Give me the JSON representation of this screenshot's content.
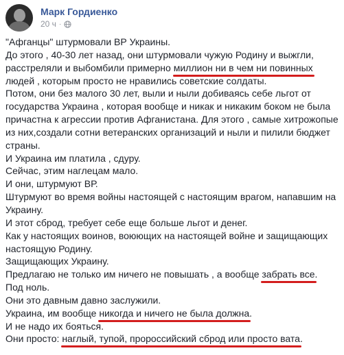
{
  "header": {
    "author": "Марк Гордиенко",
    "time": "20 ч",
    "separator": "·",
    "privacy_icon": "globe-icon"
  },
  "colors": {
    "author_link": "#385898",
    "meta": "#90949c",
    "underline": "#d31d1d"
  },
  "post": {
    "l1": "\"Афганцы\" штурмовали ВР Украины.",
    "l2": "До этого , 40-30 лет назад, они штурмовали чужую Родину и выжгли,",
    "l3_pre": "расстреляли и выбомбили примерно ",
    "l3_hl": "миллион ни в чем ни повинных",
    "l4": "людей , которым просто не нравились советские солдаты.",
    "l5": "Потом, они без малого 30 лет, выли и ныли добиваясь себе льгот от",
    "l6": "государства Украина , которая вообще и никак и никаким боком не была",
    "l7": "причастна к агрессии против Афганистана. Для этого , самые хитрожопые",
    "l8": "из них,создали сотни ветеранских организаций и ныли и пилили бюджет",
    "l9": "страны.",
    "l10": "И Украина им платила , сдуру.",
    "l11": "Сейчас, этим наглецам мало.",
    "l12": "И они, штурмуют ВР.",
    "l13": "Штурмуют во время войны настоящей с настоящим врагом, напавшим на",
    "l14": "Украину.",
    "l15": "И этот сброд, требует себе еще больше льгот и денег.",
    "l16": "Как у настоящих воинов, воюющих на настоящей войне и защищающих",
    "l17": "настоящую Родину.",
    "l18": "Защищающих Украину.",
    "l19_pre": "Предлагаю не только им ничего не повышать , а вообще ",
    "l19_hl": "забрать все",
    "l19_post": ".",
    "l20": "Под ноль.",
    "l21": "Они это давным давно заслужили.",
    "l22_pre": "Украина, им вообще ",
    "l22_hl": "никогда и ничего не была должна",
    "l22_post": ".",
    "l23": "И не надо их бояться.",
    "l24_pre": "Они просто: ",
    "l24_hl": "наглый, тупой, пророссийский сброд или просто вата",
    "l24_post": "."
  }
}
